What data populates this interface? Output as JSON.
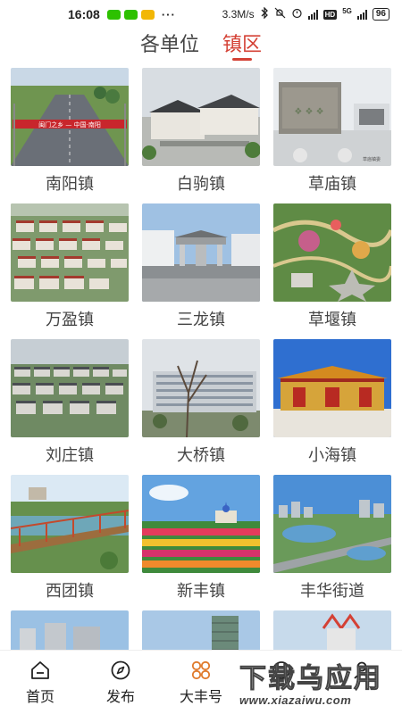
{
  "status_bar": {
    "time": "16:08",
    "dots": "···",
    "network_speed": "3.3M/s",
    "network_type": "5G",
    "hd": "HD",
    "battery": "96"
  },
  "tabs": [
    {
      "label": "各单位",
      "active": false
    },
    {
      "label": "镇区",
      "active": true
    }
  ],
  "towns": [
    {
      "name": "南阳镇",
      "banner": "闽门之乡 — 中国·南阳"
    },
    {
      "name": "白驹镇"
    },
    {
      "name": "草庙镇",
      "caption": "草庙镇委"
    },
    {
      "name": "万盈镇"
    },
    {
      "name": "三龙镇"
    },
    {
      "name": "草堰镇"
    },
    {
      "name": "刘庄镇"
    },
    {
      "name": "大桥镇"
    },
    {
      "name": "小海镇"
    },
    {
      "name": "西团镇"
    },
    {
      "name": "新丰镇"
    },
    {
      "name": "丰华街道"
    }
  ],
  "bottom_nav": [
    {
      "label": "首页",
      "icon": "home-icon"
    },
    {
      "label": "发布",
      "icon": "compass-icon"
    },
    {
      "label": "大丰号",
      "icon": "grid-icon",
      "active": true
    },
    {
      "label": "",
      "icon": "tab4-icon"
    },
    {
      "label": "",
      "icon": "tab5-icon"
    }
  ],
  "watermark": {
    "main": "下载乌应用",
    "sub": "www.xiazaiwu.com"
  },
  "colors": {
    "accent": "#d44135",
    "nav_active": "#e07a2b"
  }
}
